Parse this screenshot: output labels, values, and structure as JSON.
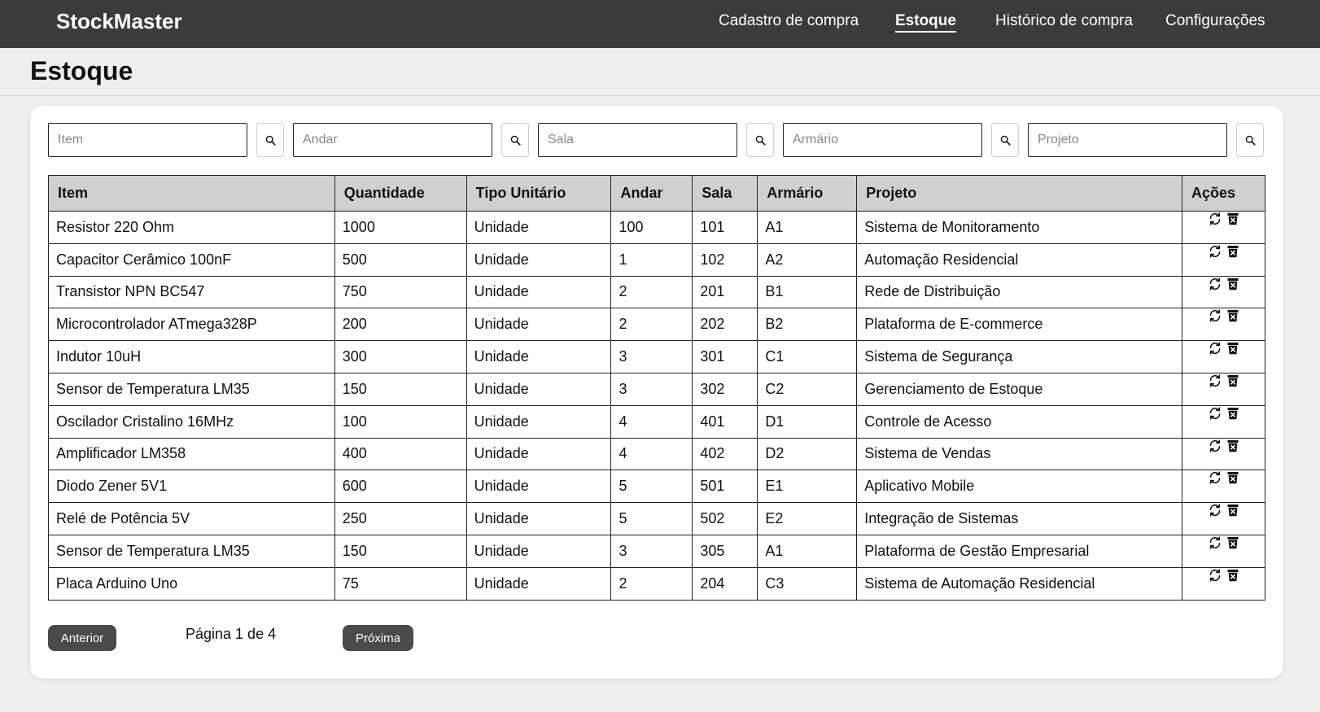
{
  "app": {
    "brand": "StockMaster"
  },
  "nav": {
    "items": [
      {
        "label": "Cadastro de compra",
        "active": false
      },
      {
        "label": "Estoque",
        "active": true
      },
      {
        "label": "Histórico de compra",
        "active": false
      },
      {
        "label": "Configurações",
        "active": false
      }
    ]
  },
  "page": {
    "title": "Estoque"
  },
  "filters": {
    "item": {
      "placeholder": "Item",
      "value": ""
    },
    "andar": {
      "placeholder": "Andar",
      "value": ""
    },
    "sala": {
      "placeholder": "Sala",
      "value": ""
    },
    "armario": {
      "placeholder": "Armário",
      "value": ""
    },
    "projeto": {
      "placeholder": "Projeto",
      "value": ""
    },
    "search_icon": "search-icon"
  },
  "table": {
    "columns": [
      "Item",
      "Quantidade",
      "Tipo Unitário",
      "Andar",
      "Sala",
      "Armário",
      "Projeto",
      "Ações"
    ],
    "rows": [
      [
        "Resistor 220 Ohm",
        "1000",
        "Unidade",
        "100",
        "101",
        "A1",
        "Sistema de Monitoramento"
      ],
      [
        "Capacitor Cerâmico 100nF",
        "500",
        "Unidade",
        "1",
        "102",
        "A2",
        "Automação Residencial"
      ],
      [
        "Transistor NPN BC547",
        "750",
        "Unidade",
        "2",
        "201",
        "B1",
        "Rede de Distribuição"
      ],
      [
        "Microcontrolador ATmega328P",
        "200",
        "Unidade",
        "2",
        "202",
        "B2",
        "Plataforma de E-commerce"
      ],
      [
        "Indutor 10uH",
        "300",
        "Unidade",
        "3",
        "301",
        "C1",
        "Sistema de Segurança"
      ],
      [
        "Sensor de Temperatura LM35",
        "150",
        "Unidade",
        "3",
        "302",
        "C2",
        "Gerenciamento de Estoque"
      ],
      [
        "Oscilador Cristalino 16MHz",
        "100",
        "Unidade",
        "4",
        "401",
        "D1",
        "Controle de Acesso"
      ],
      [
        "Amplificador LM358",
        "400",
        "Unidade",
        "4",
        "402",
        "D2",
        "Sistema de Vendas"
      ],
      [
        "Diodo Zener 5V1",
        "600",
        "Unidade",
        "5",
        "501",
        "E1",
        "Aplicativo Mobile"
      ],
      [
        "Relé de Potência 5V",
        "250",
        "Unidade",
        "5",
        "502",
        "E2",
        "Integração de Sistemas"
      ],
      [
        "Sensor de Temperatura LM35",
        "150",
        "Unidade",
        "3",
        "305",
        "A1",
        "Plataforma de Gestão Empresarial"
      ],
      [
        "Placa Arduino Uno",
        "75",
        "Unidade",
        "2",
        "204",
        "C3",
        "Sistema de Automação Residencial"
      ]
    ],
    "row_actions": [
      {
        "icon": "refresh-icon"
      },
      {
        "icon": "trash-icon"
      }
    ]
  },
  "pagination": {
    "prev_label": "Anterior",
    "next_label": "Próxima",
    "info": "Página 1 de 4"
  },
  "colors": {
    "topbar": "#3b3b3b",
    "background": "#efefef",
    "table_header": "#d0d0d0",
    "button": "#4a4a4a"
  }
}
